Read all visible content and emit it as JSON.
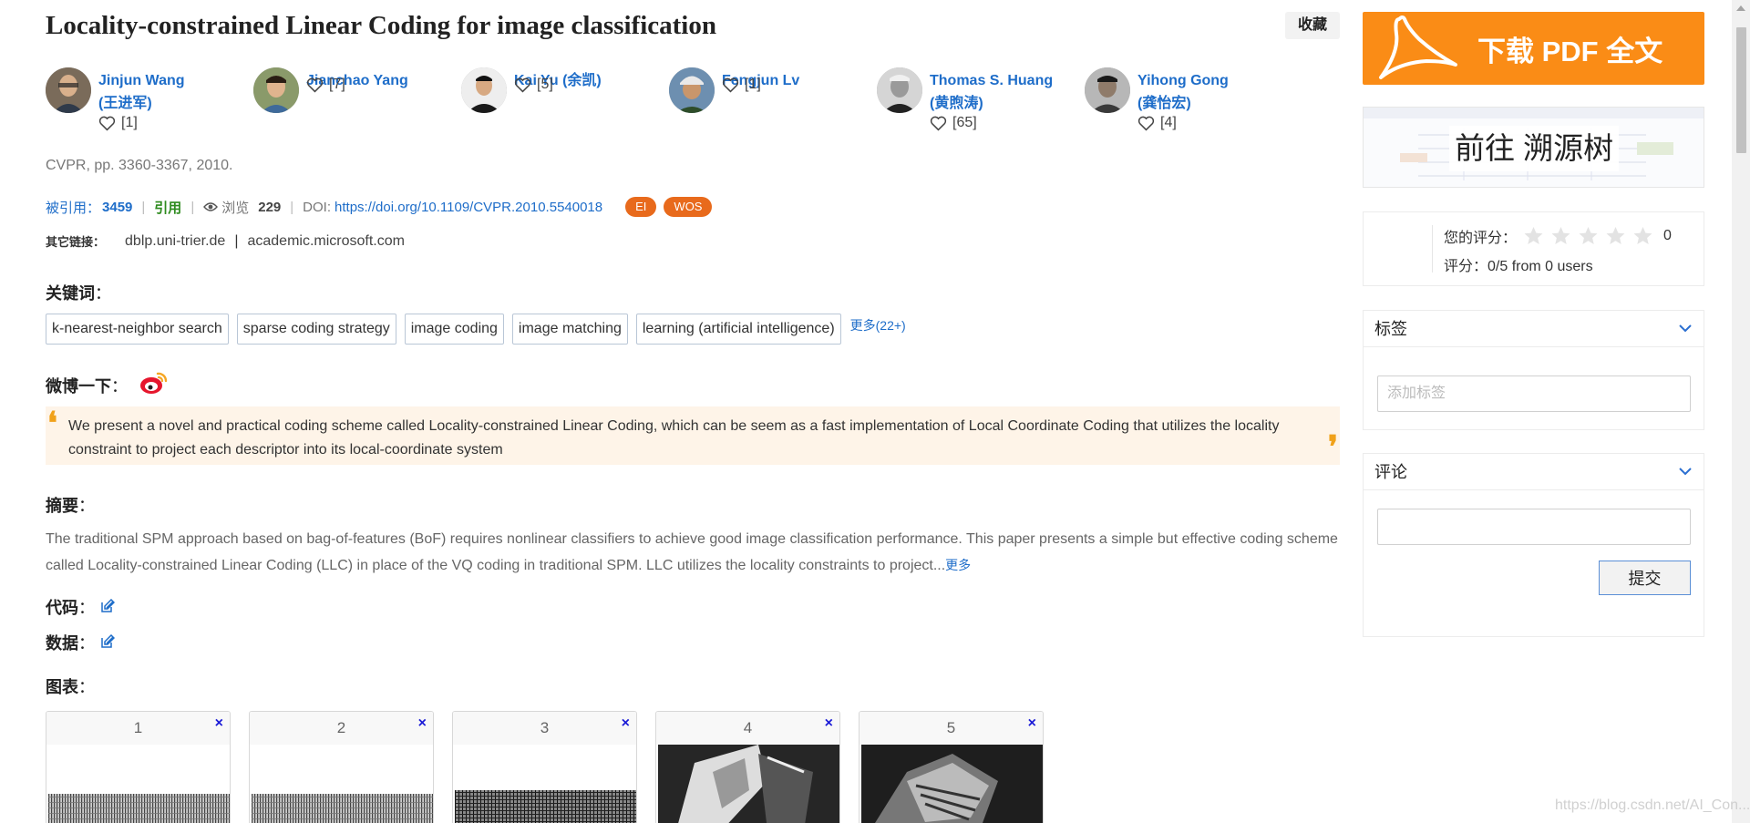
{
  "paper": {
    "title": "Locality-constrained Linear Coding for image classification",
    "favorite_label": "收藏",
    "venue": "CVPR, pp. 3360-3367, 2010."
  },
  "authors": [
    {
      "name": "Jinjun Wang",
      "alt_name": "(王进军)",
      "likes": "[1]"
    },
    {
      "name": "Jianchao Yang",
      "alt_name": "",
      "likes": "[7]"
    },
    {
      "name": "Kai Yu (余凯)",
      "alt_name": "",
      "likes": "[5]"
    },
    {
      "name": "Fengjun Lv",
      "alt_name": "",
      "likes": "[1]"
    },
    {
      "name": "Thomas S. Huang",
      "alt_name": "(黄煦涛)",
      "likes": "[65]"
    },
    {
      "name": "Yihong Gong",
      "alt_name": "(龚怡宏)",
      "likes": "[4]"
    }
  ],
  "meta": {
    "cited_label": "被引用：",
    "cited_count": "3459",
    "sep": "|",
    "quote_label": "引用",
    "views_label": "浏览",
    "views_count": "229",
    "doi_label": "DOI: ",
    "doi_link": "https://doi.org/10.1109/CVPR.2010.5540018",
    "badges": [
      "EI",
      "WOS"
    ]
  },
  "other_links": {
    "label": "其它链接：",
    "items": [
      "dblp.uni-trier.de",
      "academic.microsoft.com"
    ],
    "sep": "|"
  },
  "keywords": {
    "heading": "关键词",
    "items": [
      "k-nearest-neighbor search",
      "sparse coding strategy",
      "image coding",
      "image matching",
      "learning (artificial intelligence)"
    ],
    "more": "更多(22+)"
  },
  "weibo": {
    "heading": "微博一下"
  },
  "highlight": {
    "text": "We present a novel and practical coding scheme called Locality-constrained Linear Coding, which can be seem as a fast implementation of Local Coordinate Coding that utilizes the locality constraint to project each descriptor into its local-coordinate system"
  },
  "abstract": {
    "heading": "摘要",
    "text": "The traditional SPM approach based on bag-of-features (BoF) requires nonlinear classifiers to achieve good image classification performance. This paper presents a simple but effective coding scheme called Locality-constrained Linear Coding (LLC) in place of the VQ coding in traditional SPM. LLC utilizes the locality constraints to project...",
    "more": "更多"
  },
  "code": {
    "heading": "代码"
  },
  "data_section": {
    "heading": "数据"
  },
  "figures": {
    "heading": "图表",
    "items": [
      {
        "number": "1",
        "close": "×"
      },
      {
        "number": "2",
        "close": "×"
      },
      {
        "number": "3",
        "close": "×"
      },
      {
        "number": "4",
        "close": "×"
      },
      {
        "number": "5",
        "close": "×"
      }
    ]
  },
  "colon": "：",
  "sidebar": {
    "pdf_button": "下载 PDF 全文",
    "tree_button": "前往 溯源树",
    "rating": {
      "your_label": "您的评分：",
      "your_value": "0",
      "stars": 5,
      "summary": "评分：0/5 from 0 users"
    },
    "tags": {
      "title": "标签",
      "placeholder": "添加标签"
    },
    "comments": {
      "title": "评论",
      "submit": "提交"
    }
  },
  "watermark": "https://blog.csdn.net/AI_Con..."
}
